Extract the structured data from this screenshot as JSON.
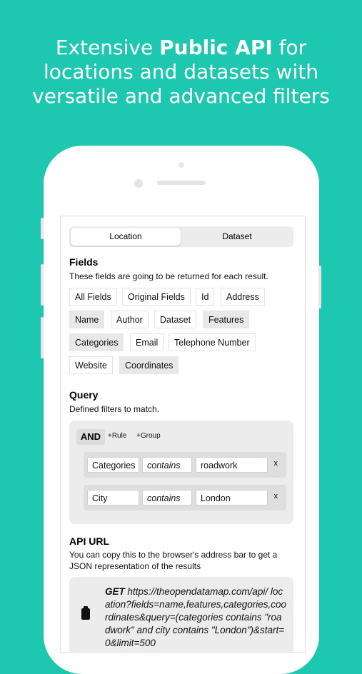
{
  "headline": {
    "part1": "Extensive ",
    "bold": "Public API",
    "part2": " for",
    "line2": "locations and datasets with",
    "line3": "versatile and advanced filters"
  },
  "tabs": {
    "location": "Location",
    "dataset": "Dataset",
    "selected": "Location"
  },
  "fields": {
    "title": "Fields",
    "description": "These fields are going to be returned for each result.",
    "chips": [
      {
        "label": "All Fields",
        "selected": false
      },
      {
        "label": "Original Fields",
        "selected": false
      },
      {
        "label": "Id",
        "selected": false
      },
      {
        "label": "Address",
        "selected": false
      },
      {
        "label": "Name",
        "selected": true
      },
      {
        "label": "Author",
        "selected": false
      },
      {
        "label": "Dataset",
        "selected": false
      },
      {
        "label": "Features",
        "selected": true
      },
      {
        "label": "Categories",
        "selected": true
      },
      {
        "label": "Email",
        "selected": false
      },
      {
        "label": "Telephone Number",
        "selected": false
      },
      {
        "label": "Website",
        "selected": false
      },
      {
        "label": "Coordinates",
        "selected": true
      }
    ]
  },
  "query": {
    "title": "Query",
    "description": "Defined filters to match.",
    "combinator": "AND",
    "add_rule": "+Rule",
    "add_group": "+Group",
    "rules": [
      {
        "field": "Categories",
        "operator": "contains",
        "value": "roadwork",
        "remove": "x"
      },
      {
        "field": "City",
        "operator": "contains",
        "value": "London",
        "remove": "x"
      }
    ]
  },
  "api_url": {
    "title": "API URL",
    "description": "You can copy this to the browser's address bar to get a JSON representation of the results",
    "method": "GET",
    "url": " https://theopendatamap.com/api/ location?fields=name,features,categories,coordinates&query=(categories contains \"roadwork\" and city contains \"London\")&start=0&limit=500"
  }
}
